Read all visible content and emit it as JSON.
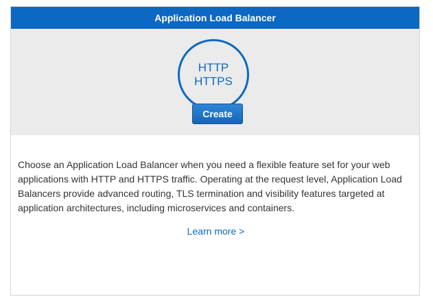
{
  "card": {
    "title": "Application Load Balancer",
    "protocols": [
      "HTTP",
      "HTTPS"
    ],
    "create_label": "Create",
    "description": "Choose an Application Load Balancer when you need a flexible feature set for your web applications with HTTP and HTTPS traffic. Operating at the request level, Application Load Balancers provide advanced routing, TLS termination and visibility features targeted at application architectures, including microservices and containers.",
    "learn_more_label": "Learn more >"
  },
  "colors": {
    "accent": "#0c68c2",
    "hero_background": "#ebebeb",
    "text": "#333333"
  }
}
